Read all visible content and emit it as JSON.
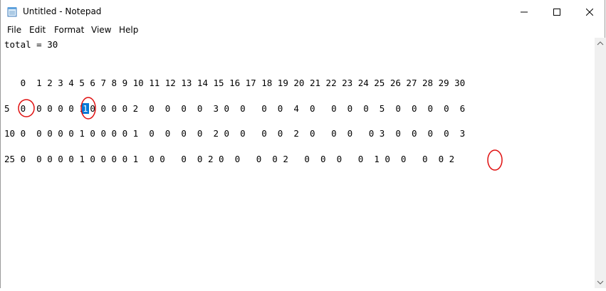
{
  "window": {
    "title": "Untitled - Notepad"
  },
  "menu": [
    "File",
    "Edit",
    "Format",
    "View",
    "Help"
  ],
  "editor": {
    "lines": [
      "total = 30",
      "",
      "",
      "   0  1 2 3 4 5 6 7 8 9 10 11 12 13 14 15 16 17 18 19 20 21 22 23 24 25 26 27 28 29 30",
      "",
      "5  0  0 0 0 0 1 0 0 0 0 2  0  0  0  0  3 0  0   0  0  4  0   0  0  0  5  0  0  0  0  6",
      "",
      "10 0  0 0 0 0 1 0 0 0 0 1  0  0  0  0  2 0  0   0  0  2  0   0  0   0 3  0  0  0  0  3",
      "",
      "25 0  0 0 0 0 1 0 0 0 0 1  0 0   0  0 2 0  0   0  0 2   0  0  0   0  1 0  0   0  0 2"
    ],
    "selected_text": "1"
  },
  "icons": {
    "app": "notepad-icon",
    "minimize": "minimize-icon",
    "maximize": "maximize-icon",
    "close": "close-icon"
  },
  "colors": {
    "selection": "#0078d7",
    "annotation": "#e01010"
  }
}
